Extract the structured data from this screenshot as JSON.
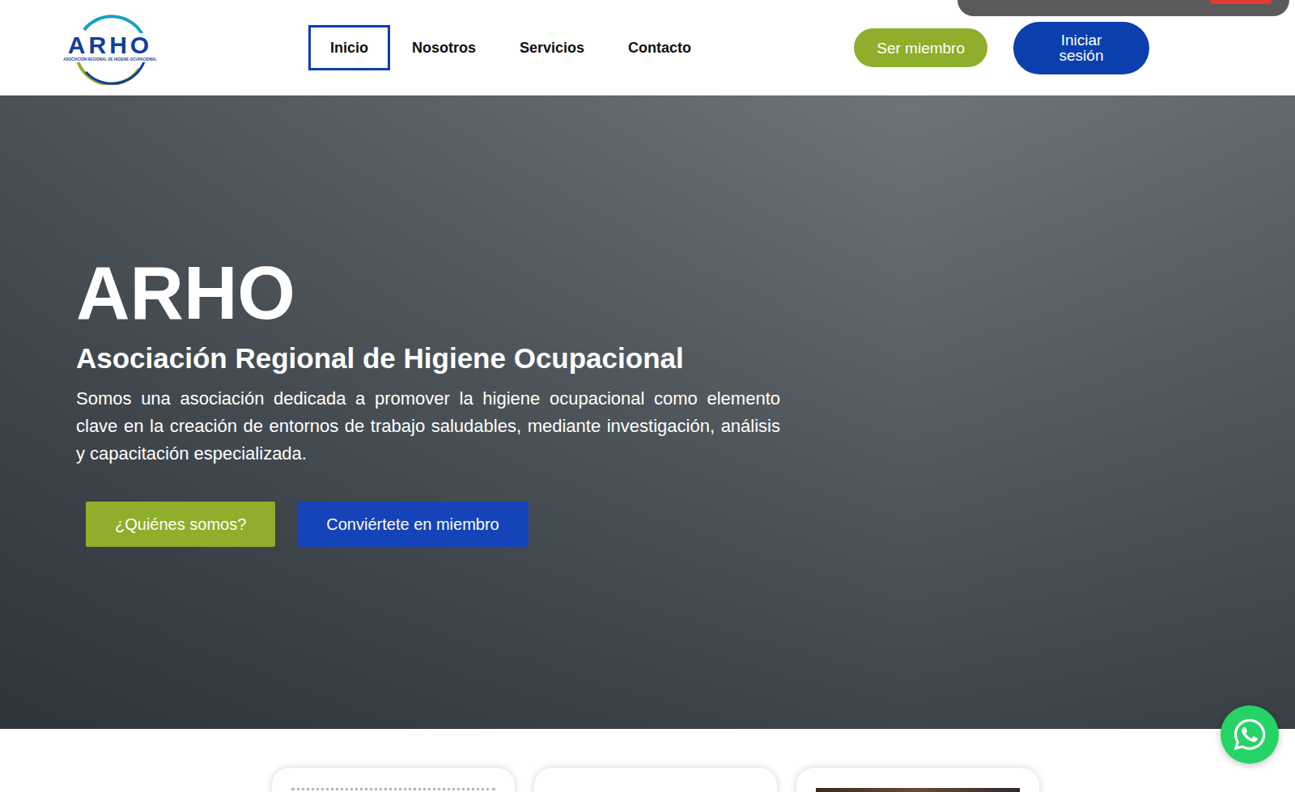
{
  "logo": {
    "name": "ARHO",
    "tagline": "ASOCIACIÓN REGIONAL DE HIGIENE OCUPACIONAL"
  },
  "nav": [
    {
      "label": "Inicio",
      "selected": true
    },
    {
      "label": "Nosotros",
      "selected": false
    },
    {
      "label": "Servicios",
      "selected": false
    },
    {
      "label": "Contacto",
      "selected": false
    }
  ],
  "header_buttons": [
    {
      "label": "Ser miembro",
      "kind": "secondary"
    },
    {
      "label": "Iniciar sesión",
      "kind": "primary"
    }
  ],
  "hero": {
    "title": "ARHO",
    "subtitle": "Asociación Regional de Higiene Ocupacional",
    "description": "Somos una asociación dedicada a promover la higiene ocupacional como elemento clave en la creación de entornos de trabajo saludables, mediante investigación, análisis y capacitación especializada.",
    "buttons": [
      {
        "label": "¿Quiénes somos?",
        "kind": "secondary"
      },
      {
        "label": "Conviértete en miembro",
        "kind": "primary"
      }
    ]
  },
  "cards": [
    {
      "kind": "pattern"
    },
    {
      "kind": "blank"
    },
    {
      "kind": "photo"
    }
  ]
}
